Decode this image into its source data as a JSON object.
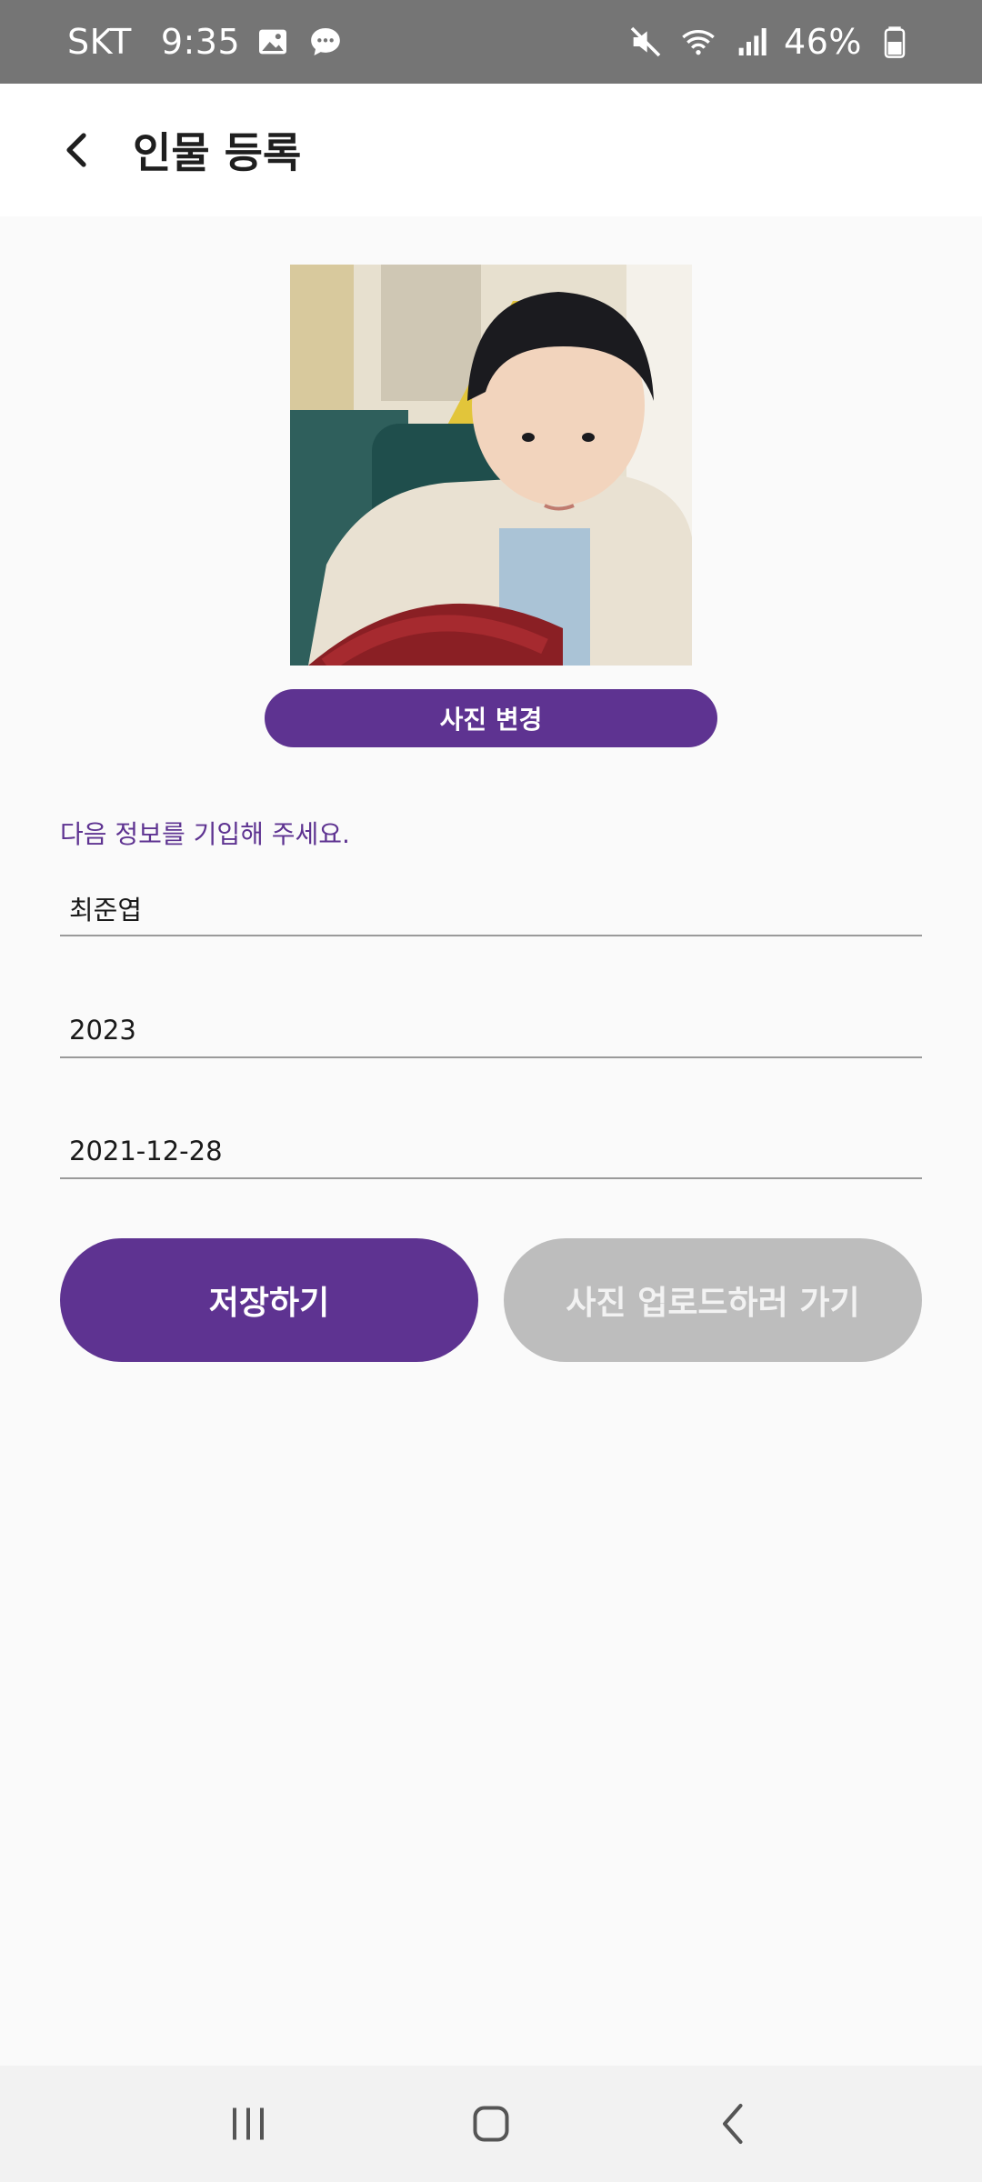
{
  "status_bar": {
    "carrier": "SKT",
    "time": "9:35",
    "battery": "46%",
    "icons": [
      "gallery-icon",
      "chat-icon",
      "mute-icon",
      "wifi-icon",
      "signal-icon",
      "battery-icon"
    ]
  },
  "header": {
    "title": "인물 등록"
  },
  "photo": {
    "change_label": "사진 변경"
  },
  "form": {
    "prompt": "다음 정보를 기입해 주세요.",
    "name_value": "최준엽",
    "year_value": "2023",
    "birthdate_value": "2021-12-28"
  },
  "actions": {
    "save_label": "저장하기",
    "upload_label": "사진 업로드하러 가기"
  },
  "colors": {
    "accent": "#5e3391",
    "disabled_button": "#bdbdbd",
    "status_bar": "#757575",
    "background": "#fafafa"
  }
}
